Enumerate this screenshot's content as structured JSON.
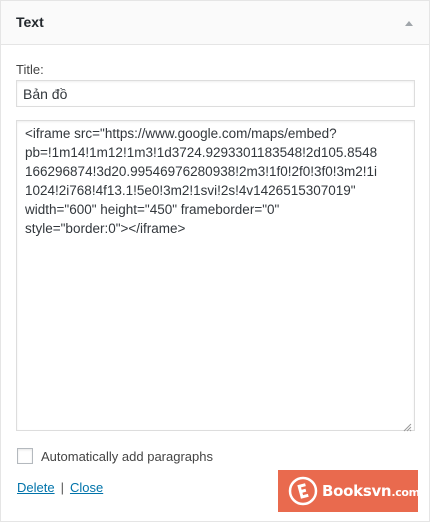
{
  "widget": {
    "title": "Text",
    "title_field_label": "Title:",
    "title_value": "Bản đồ",
    "content_lines": [
      "<iframe src=\"https://www.google.com/maps/embed?",
      "pb=!1m14!1m12!1m3!1d3724.9293301183548!2d105.8548",
      "166296874!3d20.99546976280938!2m3!1f0!2f0!3f0!3m2!1i",
      "1024!2i768!4f13.1!5e0!3m2!1svi!2s!4v1426515307019\"",
      "width=\"600\" height=\"450\" frameborder=\"0\"",
      "style=\"border:0\"></iframe>"
    ],
    "auto_paragraphs_label": "Automatically add paragraphs",
    "auto_paragraphs_checked": false,
    "delete_label": "Delete",
    "separator": "|",
    "close_label": "Close"
  },
  "watermark": {
    "brand": "Booksvn",
    "suffix": ".com",
    "color": "#e96a4e"
  },
  "icons": {
    "toggle": "arrow-up-icon",
    "resize": "resize-grip-icon",
    "logo": "booksvn-logo-icon"
  }
}
